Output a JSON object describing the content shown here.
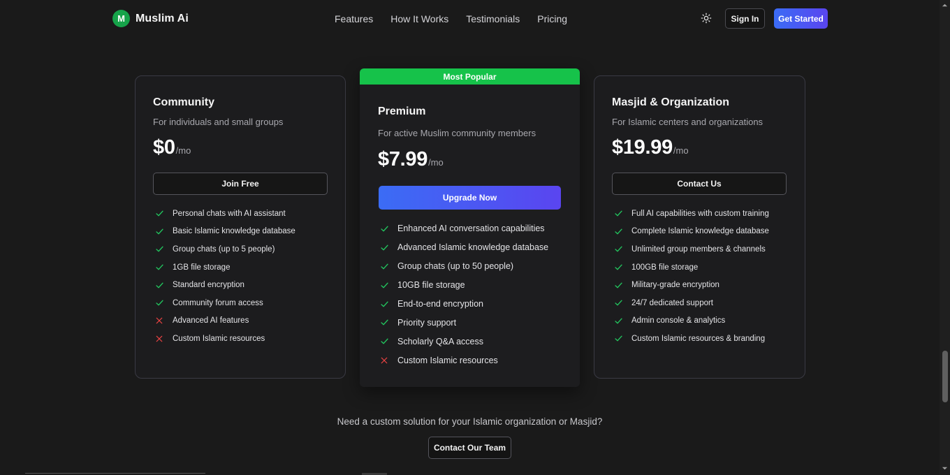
{
  "brand": {
    "logo_letter": "M",
    "name": "Muslim Ai",
    "color": "#16a34a"
  },
  "nav": {
    "items": [
      {
        "label": "Features"
      },
      {
        "label": "How It Works"
      },
      {
        "label": "Testimonials"
      },
      {
        "label": "Pricing"
      }
    ]
  },
  "header": {
    "theme_icon": "sun-icon",
    "signin_label": "Sign In",
    "getstarted_label": "Get Started"
  },
  "plans": {
    "community": {
      "name": "Community",
      "description": "For individuals and small groups",
      "price": "$0",
      "period": "/mo",
      "button": "Join Free",
      "features": [
        {
          "text": "Personal chats with AI assistant",
          "included": true
        },
        {
          "text": "Basic Islamic knowledge database",
          "included": true
        },
        {
          "text": "Group chats (up to 5 people)",
          "included": true
        },
        {
          "text": "1GB file storage",
          "included": true
        },
        {
          "text": "Standard encryption",
          "included": true
        },
        {
          "text": "Community forum access",
          "included": true
        },
        {
          "text": "Advanced AI features",
          "included": false
        },
        {
          "text": "Custom Islamic resources",
          "included": false
        }
      ]
    },
    "premium": {
      "badge": "Most Popular",
      "name": "Premium",
      "description": "For active Muslim community members",
      "price": "$7.99",
      "period": "/mo",
      "button": "Upgrade Now",
      "features": [
        {
          "text": "Enhanced AI conversation capabilities",
          "included": true
        },
        {
          "text": "Advanced Islamic knowledge database",
          "included": true
        },
        {
          "text": "Group chats (up to 50 people)",
          "included": true
        },
        {
          "text": "10GB file storage",
          "included": true
        },
        {
          "text": "End-to-end encryption",
          "included": true
        },
        {
          "text": "Priority support",
          "included": true
        },
        {
          "text": "Scholarly Q&A access",
          "included": true
        },
        {
          "text": "Custom Islamic resources",
          "included": false
        }
      ]
    },
    "organization": {
      "name": "Masjid & Organization",
      "description": "For Islamic centers and organizations",
      "price": "$19.99",
      "period": "/mo",
      "button": "Contact Us",
      "features": [
        {
          "text": "Full AI capabilities with custom training",
          "included": true
        },
        {
          "text": "Complete Islamic knowledge database",
          "included": true
        },
        {
          "text": "Unlimited group members & channels",
          "included": true
        },
        {
          "text": "100GB file storage",
          "included": true
        },
        {
          "text": "Military-grade encryption",
          "included": true
        },
        {
          "text": "24/7 dedicated support",
          "included": true
        },
        {
          "text": "Admin console & analytics",
          "included": true
        },
        {
          "text": "Custom Islamic resources & branding",
          "included": true
        }
      ]
    }
  },
  "cta": {
    "text": "Need a custom solution for your Islamic organization or Masjid?",
    "button": "Contact Our Team"
  },
  "colors": {
    "check": "#22c55e",
    "cross": "#ef4444",
    "badge": "#16c24a",
    "accent_start": "#3b6cf5",
    "accent_end": "#5a45f0"
  }
}
